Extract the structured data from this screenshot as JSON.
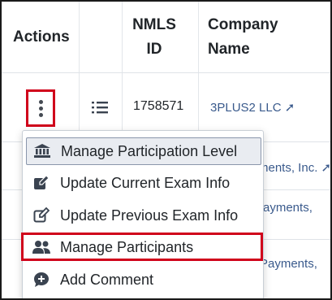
{
  "table": {
    "headers": {
      "actions": "Actions",
      "nmls_line1": "NMLS",
      "nmls_line2": "ID",
      "company_line1": "Company",
      "company_line2": "Name"
    },
    "row1": {
      "nmls_id": "1758571",
      "company": "3PLUS2 LLC ➚"
    },
    "partial_rows": {
      "row2_company": "ments, Inc. ➚",
      "row3_company": "ayments,",
      "row4_company": "Payments,"
    }
  },
  "menu": {
    "items": [
      {
        "label": "Manage Participation Level",
        "icon": "bank-icon"
      },
      {
        "label": "Update Current Exam Info",
        "icon": "edit-square-icon"
      },
      {
        "label": "Update Previous Exam Info",
        "icon": "edit-outline-icon"
      },
      {
        "label": "Manage Participants",
        "icon": "users-icon"
      },
      {
        "label": "Add Comment",
        "icon": "comment-plus-icon"
      }
    ]
  },
  "colors": {
    "highlight": "#d0021b",
    "link": "#3a5a8c",
    "active_item_bg": "#e9ecf1"
  }
}
